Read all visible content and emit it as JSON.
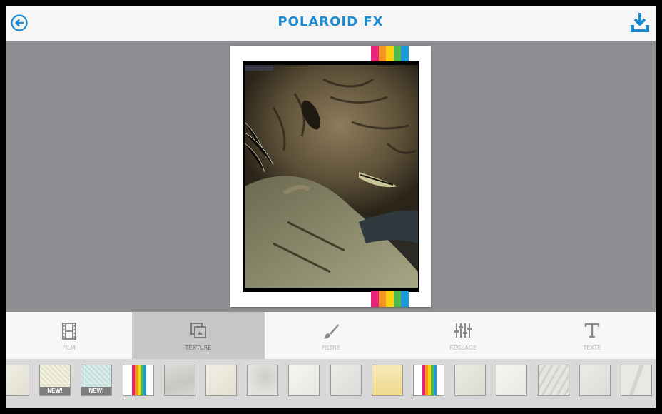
{
  "header": {
    "title": "POLAROID FX"
  },
  "colors": {
    "accent": "#1b8bd1",
    "stripe": [
      "#e9237c",
      "#f79320",
      "#fcd20f",
      "#52b84b",
      "#1b9ad6"
    ]
  },
  "tabs": [
    {
      "label": "FILM",
      "icon": "film-icon",
      "active": false
    },
    {
      "label": "TEXTURE",
      "icon": "texture-icon",
      "active": true
    },
    {
      "label": "FILTRE",
      "icon": "brush-icon",
      "active": false
    },
    {
      "label": "REGLAGE",
      "icon": "sliders-icon",
      "active": false
    },
    {
      "label": "TEXTE",
      "icon": "text-icon",
      "active": false
    }
  ],
  "textures": [
    {
      "kind": "paper-cream",
      "badge": ""
    },
    {
      "kind": "paper-pattern-cream",
      "badge": "NEW!"
    },
    {
      "kind": "paper-pattern-mint",
      "badge": "NEW!"
    },
    {
      "kind": "polaroid-stripes",
      "badge": ""
    },
    {
      "kind": "paper-worn-grey",
      "badge": ""
    },
    {
      "kind": "paper-cream",
      "badge": ""
    },
    {
      "kind": "paper-stained",
      "badge": ""
    },
    {
      "kind": "paper-light",
      "badge": ""
    },
    {
      "kind": "paper-light-grey",
      "badge": ""
    },
    {
      "kind": "paper-yellow",
      "badge": ""
    },
    {
      "kind": "polaroid-stripes",
      "badge": ""
    },
    {
      "kind": "paper-stamped",
      "badge": ""
    },
    {
      "kind": "paper-light",
      "badge": ""
    },
    {
      "kind": "paper-crumpled",
      "badge": ""
    },
    {
      "kind": "paper-light-grey",
      "badge": ""
    },
    {
      "kind": "paper-folded",
      "badge": ""
    }
  ]
}
